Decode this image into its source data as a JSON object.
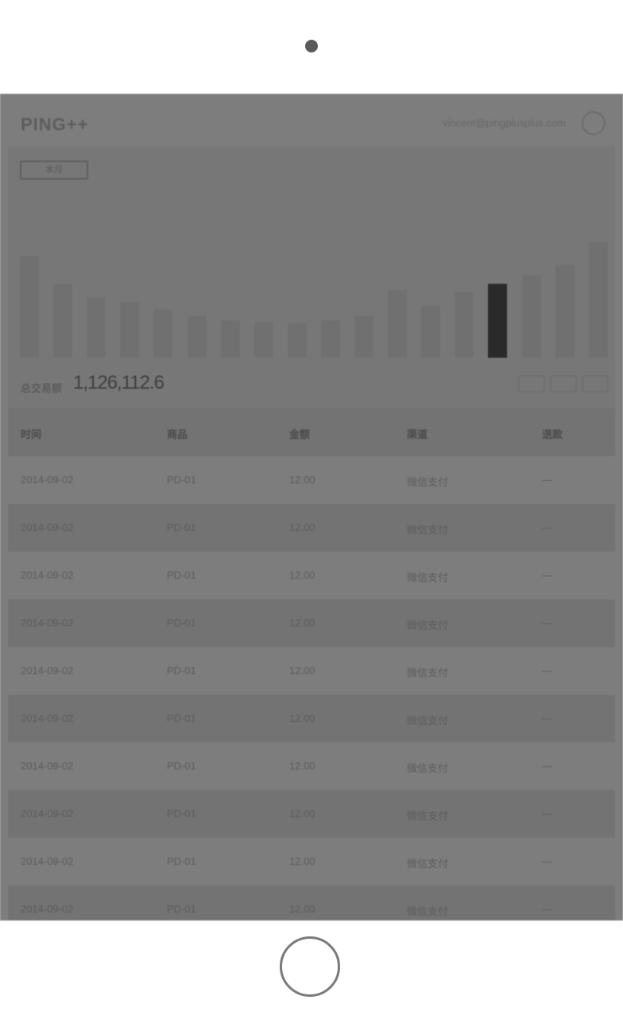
{
  "device": {
    "camera": "camera-dot",
    "home_button": "home-button"
  },
  "app": {
    "logo": "PING++",
    "user_email": "vincent@pingplusplus.com"
  },
  "chart_panel": {
    "period_label": "本月"
  },
  "chart_data": {
    "type": "bar",
    "title": "",
    "xlabel": "",
    "ylabel": "",
    "ylim": [
      0,
      100
    ],
    "values": [
      88,
      64,
      52,
      48,
      42,
      36,
      32,
      31,
      30,
      32,
      36,
      58,
      45,
      57,
      64,
      71,
      80,
      100
    ],
    "highlight_index": 14
  },
  "summary": {
    "label": "总交易额",
    "value": "1,126,112.6"
  },
  "pager": [
    "prev",
    "current",
    "next"
  ],
  "table": {
    "columns": [
      "时间",
      "商品",
      "金额",
      "渠道",
      "退款"
    ],
    "rows": [
      [
        "2014-09-02",
        "PD-01",
        "12.00",
        "微信支付",
        "—"
      ],
      [
        "2014-09-02",
        "PD-01",
        "12.00",
        "微信支付",
        "—"
      ],
      [
        "2014-09-02",
        "PD-01",
        "12.00",
        "微信支付",
        "—"
      ],
      [
        "2014-09-02",
        "PD-01",
        "12.00",
        "微信支付",
        "—"
      ],
      [
        "2014-09-02",
        "PD-01",
        "12.00",
        "微信支付",
        "—"
      ],
      [
        "2014-09-02",
        "PD-01",
        "12.00",
        "微信支付",
        "—"
      ],
      [
        "2014-09-02",
        "PD-01",
        "12.00",
        "微信支付",
        "—"
      ],
      [
        "2014-09-02",
        "PD-01",
        "12.00",
        "微信支付",
        "—"
      ],
      [
        "2014-09-02",
        "PD-01",
        "12.00",
        "微信支付",
        "—"
      ],
      [
        "2014-09-02",
        "PD-01",
        "12.00",
        "微信支付",
        "—"
      ]
    ]
  }
}
